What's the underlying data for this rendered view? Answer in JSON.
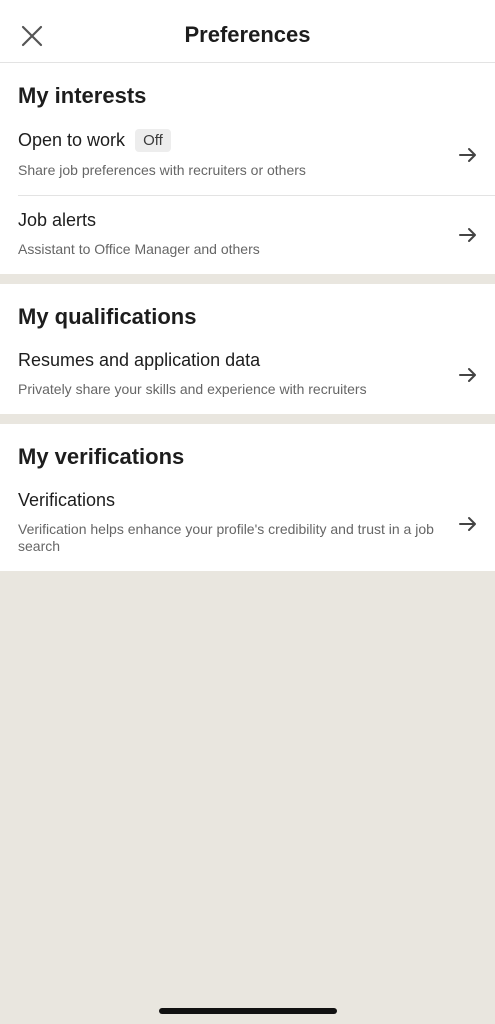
{
  "header": {
    "title": "Preferences",
    "close_icon": "close-icon"
  },
  "sections": [
    {
      "title": "My interests",
      "rows": [
        {
          "title": "Open to work",
          "badge": "Off",
          "subtitle": "Share job preferences with recruiters or others",
          "icon": "arrow-right-icon"
        },
        {
          "title": "Job alerts",
          "subtitle": "Assistant to Office Manager and others",
          "icon": "arrow-right-icon"
        }
      ]
    },
    {
      "title": "My qualifications",
      "rows": [
        {
          "title": "Resumes and application data",
          "subtitle": "Privately share your skills and experience with recruiters",
          "icon": "arrow-right-icon"
        }
      ]
    },
    {
      "title": "My verifications",
      "rows": [
        {
          "title": "Verifications",
          "subtitle": "Verification helps enhance your profile's credibility and trust in a job search",
          "icon": "arrow-right-icon"
        }
      ]
    }
  ],
  "colors": {
    "background": "#e9e6df",
    "surface": "#ffffff",
    "text_primary": "#1d1d1d",
    "text_secondary": "#666666",
    "badge_bg": "#ededed"
  }
}
